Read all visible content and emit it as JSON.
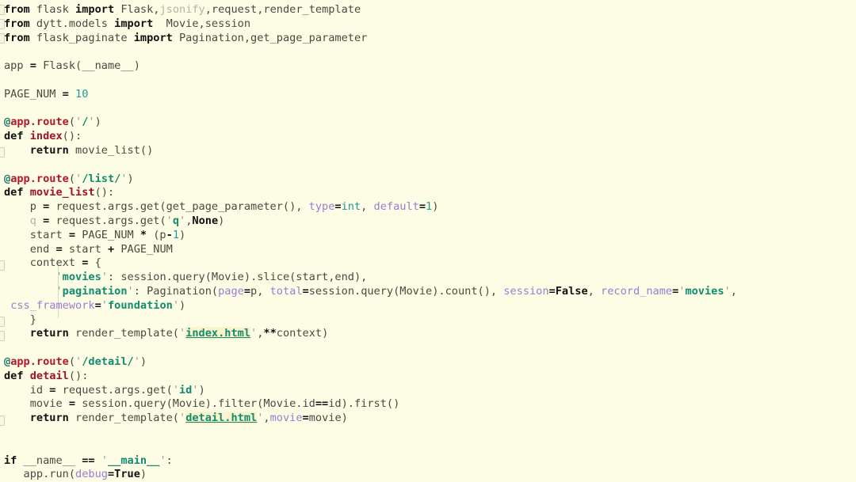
{
  "editor": {
    "language": "python",
    "background_color": "#fcfde4",
    "font_size_px": 13.6,
    "line_height_px": 17.8,
    "total_lines": 34,
    "theme_colors": {
      "background": "#fcfde4",
      "default_text": "#4a4a42",
      "keyword": "#111111",
      "decorator_at": "#1d7a6e",
      "decorator_name": "#b5182b",
      "function_name": "#a0132a",
      "number": "#1f9b9b",
      "builtin": "#1f9b9b",
      "keyword_argument": "#9a7cd4",
      "constant": "#111111",
      "quote_glyph": "#9b9b90",
      "string": "#128c6e",
      "template_link_string": "#128c6e",
      "template_link_highlight": "#faf3cd",
      "unused_symbol": "#b3b3a8",
      "indent_guide": "#d8d9c4"
    }
  },
  "code": {
    "lines": [
      "from flask import Flask,jsonify,request,render_template",
      "from dytt.models import  Movie,session",
      "from flask_paginate import Pagination,get_page_parameter",
      "",
      "app = Flask(__name__)",
      "",
      "PAGE_NUM = 10",
      "",
      "@app.route('/')",
      "def index():",
      "    return movie_list()",
      "",
      "@app.route('/list/')",
      "def movie_list():",
      "    p = request.args.get(get_page_parameter(), type=int, default=1)",
      "    q = request.args.get('q',None)",
      "    start = PAGE_NUM * (p-1)",
      "    end = start + PAGE_NUM",
      "    context = {",
      "        'movies': session.query(Movie).slice(start,end),",
      "        'pagination': Pagination(page=p, total=session.query(Movie).count(), session=False, record_name='movies',",
      " css_framework='foundation')",
      "    }",
      "    return render_template('index.html',**context)",
      "",
      "@app.route('/detail/')",
      "def detail():",
      "    id = request.args.get('id')",
      "    movie = session.query(Movie).filter(Movie.id==id).first()",
      "    return render_template('detail.html',movie=movie)",
      "",
      "if __name__ == '__main__':",
      "    app.run(debug=True)"
    ],
    "symbols": {
      "imports": [
        "flask",
        "dytt.models",
        "flask_paginate"
      ],
      "imported_names": [
        "Flask",
        "jsonify",
        "request",
        "render_template",
        "Movie",
        "session",
        "Pagination",
        "get_page_parameter"
      ],
      "unused_names": [
        "jsonify",
        "q"
      ],
      "constants": [
        "PAGE_NUM"
      ],
      "constant_values": [
        "10"
      ],
      "app_variable": "app",
      "functions": [
        "index",
        "movie_list",
        "detail"
      ],
      "routes": [
        "/",
        "/list/",
        "/detail/"
      ],
      "templates": [
        "index.html",
        "detail.html"
      ],
      "string_literals": [
        "/",
        "/list/",
        "q",
        "movies",
        "pagination",
        "movies",
        "foundation",
        "index.html",
        "/detail/",
        "id",
        "detail.html",
        "__main__"
      ],
      "keyword_arguments": [
        "type",
        "default",
        "page",
        "total",
        "session",
        "record_name",
        "css_framework",
        "movie",
        "debug"
      ],
      "literal_constants": [
        "None",
        "False",
        "True"
      ],
      "numbers": [
        "10",
        "1",
        "1"
      ],
      "builtins": [
        "int"
      ]
    }
  }
}
